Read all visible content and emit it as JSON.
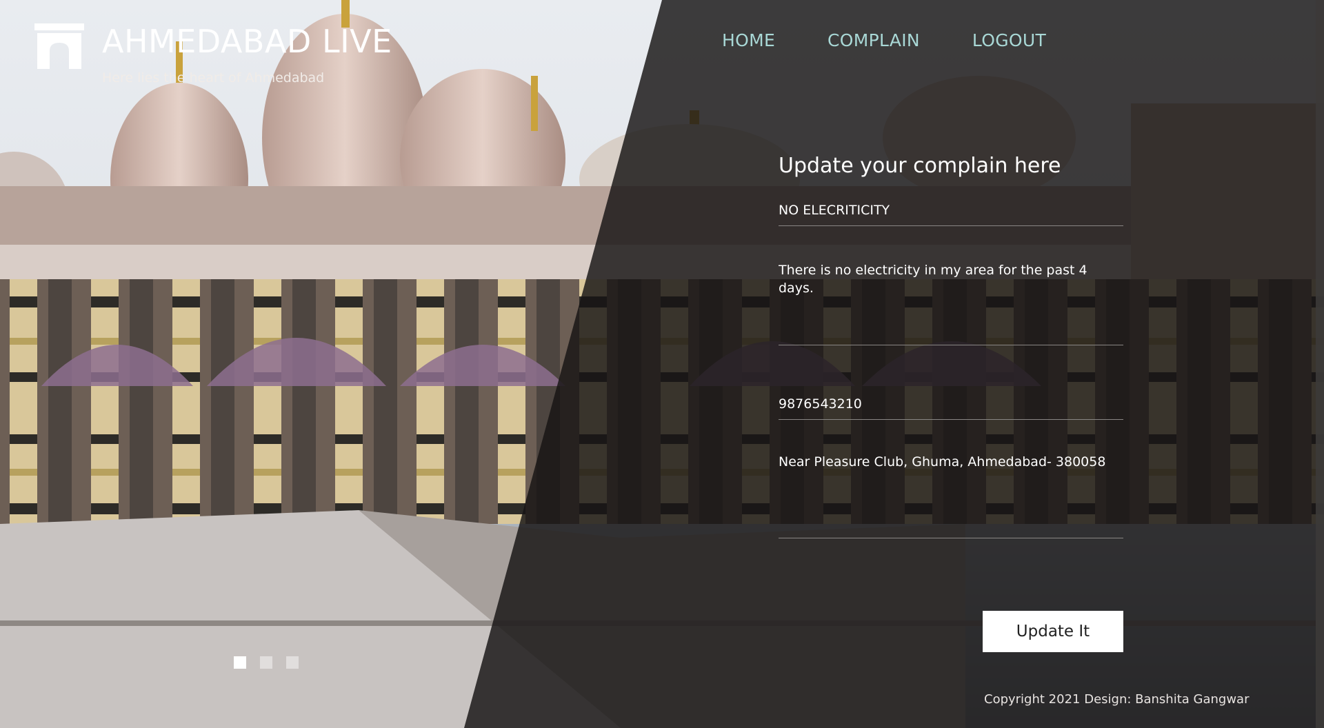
{
  "header": {
    "site_title": "AHMEDABAD LIVE",
    "tagline": "Here lies the heart of Ahmedabad",
    "logo_icon": "gate-icon"
  },
  "nav": {
    "items": [
      {
        "label": "HOME"
      },
      {
        "label": "COMPLAIN"
      },
      {
        "label": "LOGOUT"
      }
    ]
  },
  "form": {
    "heading": "Update your complain here",
    "title_value": "NO ELECRITICITY",
    "description_value": "There is no electricity in my area for the past 4 days.",
    "phone_value": "9876543210",
    "address_value": "Near Pleasure Club, Ghuma, Ahmedabad- 380058",
    "submit_label": "Update It"
  },
  "slider": {
    "slide_count": 3,
    "active_index": 0
  },
  "footer": {
    "copyright": "Copyright 2021 Design: Banshita Gangwar"
  },
  "colors": {
    "nav_link": "#a9d8d6",
    "panel": "#161413",
    "button_bg": "#ffffff"
  }
}
